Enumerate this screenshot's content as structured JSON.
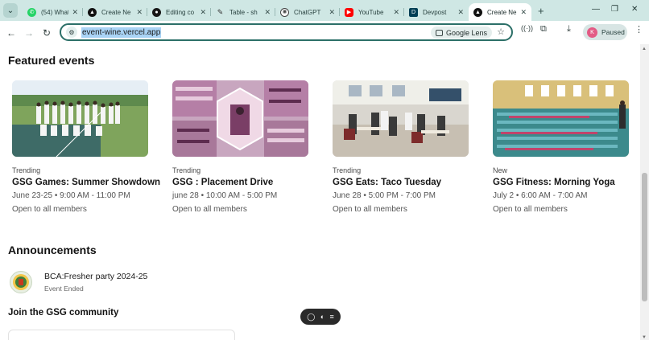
{
  "browser": {
    "tabs": [
      {
        "title": "(54) Whats",
        "favicon": "whatsapp-icon",
        "color": "#25d366"
      },
      {
        "title": "Create Ne",
        "favicon": "vercel-icon",
        "color": "#111111"
      },
      {
        "title": "Editing co",
        "favicon": "github-icon",
        "color": "#181717"
      },
      {
        "title": "Table - sh",
        "favicon": "pen-icon",
        "color": "#333333"
      },
      {
        "title": "ChatGPT",
        "favicon": "chatgpt-icon",
        "color": "#ffffff"
      },
      {
        "title": "YouTube",
        "favicon": "youtube-icon",
        "color": "#ff0000"
      },
      {
        "title": "Devpost",
        "favicon": "devpost-icon",
        "color": "#003e54"
      },
      {
        "title": "Create Ne",
        "favicon": "vercel-icon",
        "color": "#111111",
        "active": true
      }
    ],
    "new_tab_label": "+",
    "url": "event-wine.vercel.app",
    "lens_label": "Google Lens",
    "profile_initial": "K",
    "profile_status": "Paused"
  },
  "featured": {
    "heading": "Featured events",
    "events": [
      {
        "tag": "Trending",
        "name": "GSG Games: Summer Showdown",
        "when": "June 23-25 • 9:00 AM - 11:00 PM",
        "who": "Open to all members"
      },
      {
        "tag": "Trending",
        "name": "GSG : Placement Drive",
        "when": "june 28 • 10:00 AM - 5:00 PM",
        "who": "Open to all members"
      },
      {
        "tag": "Trending",
        "name": "GSG Eats: Taco Tuesday",
        "when": "June 28 • 5:00 PM - 7:00 PM",
        "who": "Open to all members"
      },
      {
        "tag": "New",
        "name": "GSG Fitness: Morning Yoga",
        "when": "July 2 • 6:00 AM - 7:00 AM",
        "who": "Open to all members"
      }
    ]
  },
  "announcements": {
    "heading": "Announcements",
    "items": [
      {
        "title": "BCA:Fresher party 2024-25",
        "status": "Event Ended"
      }
    ]
  },
  "community": {
    "heading": "Join the GSG community"
  }
}
